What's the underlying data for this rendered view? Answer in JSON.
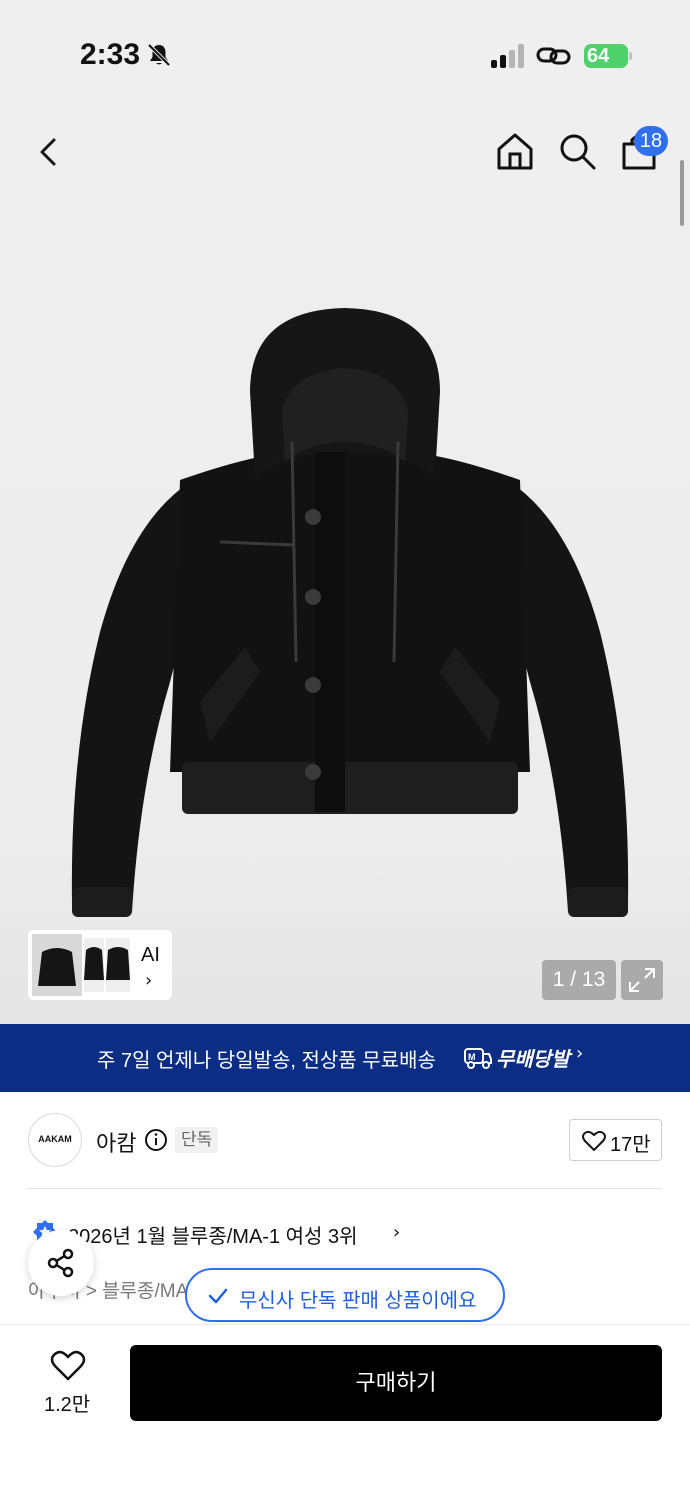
{
  "status_bar": {
    "time": "2:33",
    "battery": "64"
  },
  "header": {
    "cart_count": "18"
  },
  "gallery": {
    "thumbnail_label": "AI",
    "page_counter": "1 / 13"
  },
  "banner": {
    "text": "주 7일 언제나 당일발송, 전상품 무료배송",
    "badge": "무배당발"
  },
  "brand": {
    "logo_text": "AAKAM",
    "name": "아캄",
    "tag": "단독",
    "like_count": "17만"
  },
  "ranking": {
    "text": "2026년 1월 블루종/MA-1 여성 3위"
  },
  "breadcrumb": {
    "text": "아우터 > 블루종/MA-1"
  },
  "toast": {
    "text": "무신사 단독 판매 상품이에요"
  },
  "bottom_bar": {
    "wish_count": "1.2만",
    "buy_label": "구매하기"
  },
  "colors": {
    "accent_blue": "#2f6ff0",
    "banner_navy": "#0b2d84",
    "buy_button": "#000000",
    "battery_green": "#4ed16a"
  }
}
